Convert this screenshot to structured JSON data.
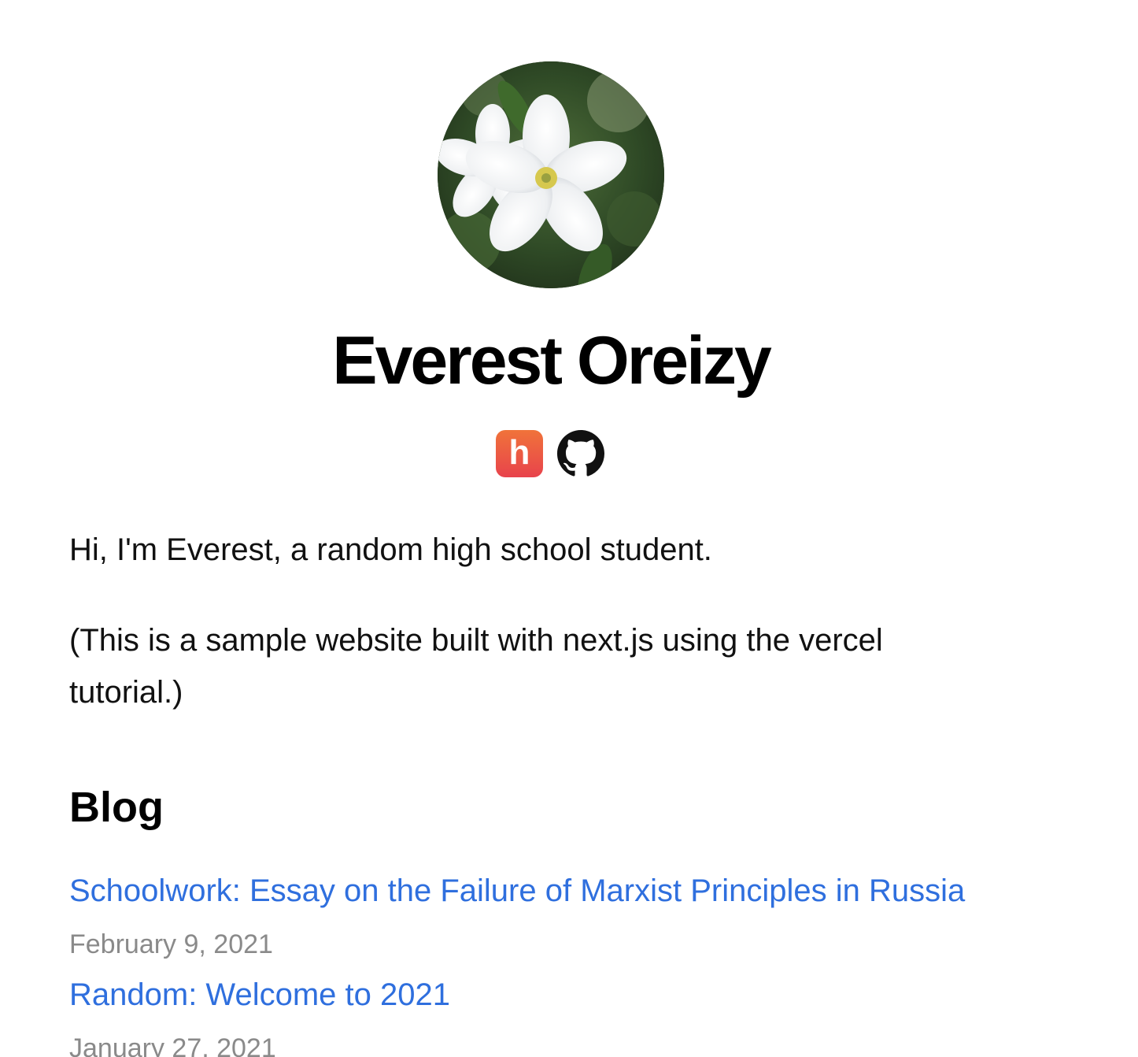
{
  "profile": {
    "name": "Everest Oreizy",
    "avatar_icon": "flower-photo"
  },
  "social": {
    "hey_label": "h",
    "hey_icon": "hey-icon",
    "github_icon": "github-icon"
  },
  "intro": {
    "greeting": "Hi, I'm Everest, a random high school student.",
    "note": "(This is a sample website built with next.js using the vercel tutorial.)"
  },
  "blog": {
    "heading": "Blog",
    "posts": [
      {
        "title": "Schoolwork: Essay on the Failure of Marxist Principles in Russia",
        "date": "February 9, 2021"
      },
      {
        "title": "Random: Welcome to 2021",
        "date": "January 27, 2021"
      }
    ]
  },
  "colors": {
    "link": "#2f6fde",
    "date": "#8a8a8a",
    "hey_gradient_top": "#f0733a",
    "hey_gradient_bottom": "#e8434c"
  }
}
